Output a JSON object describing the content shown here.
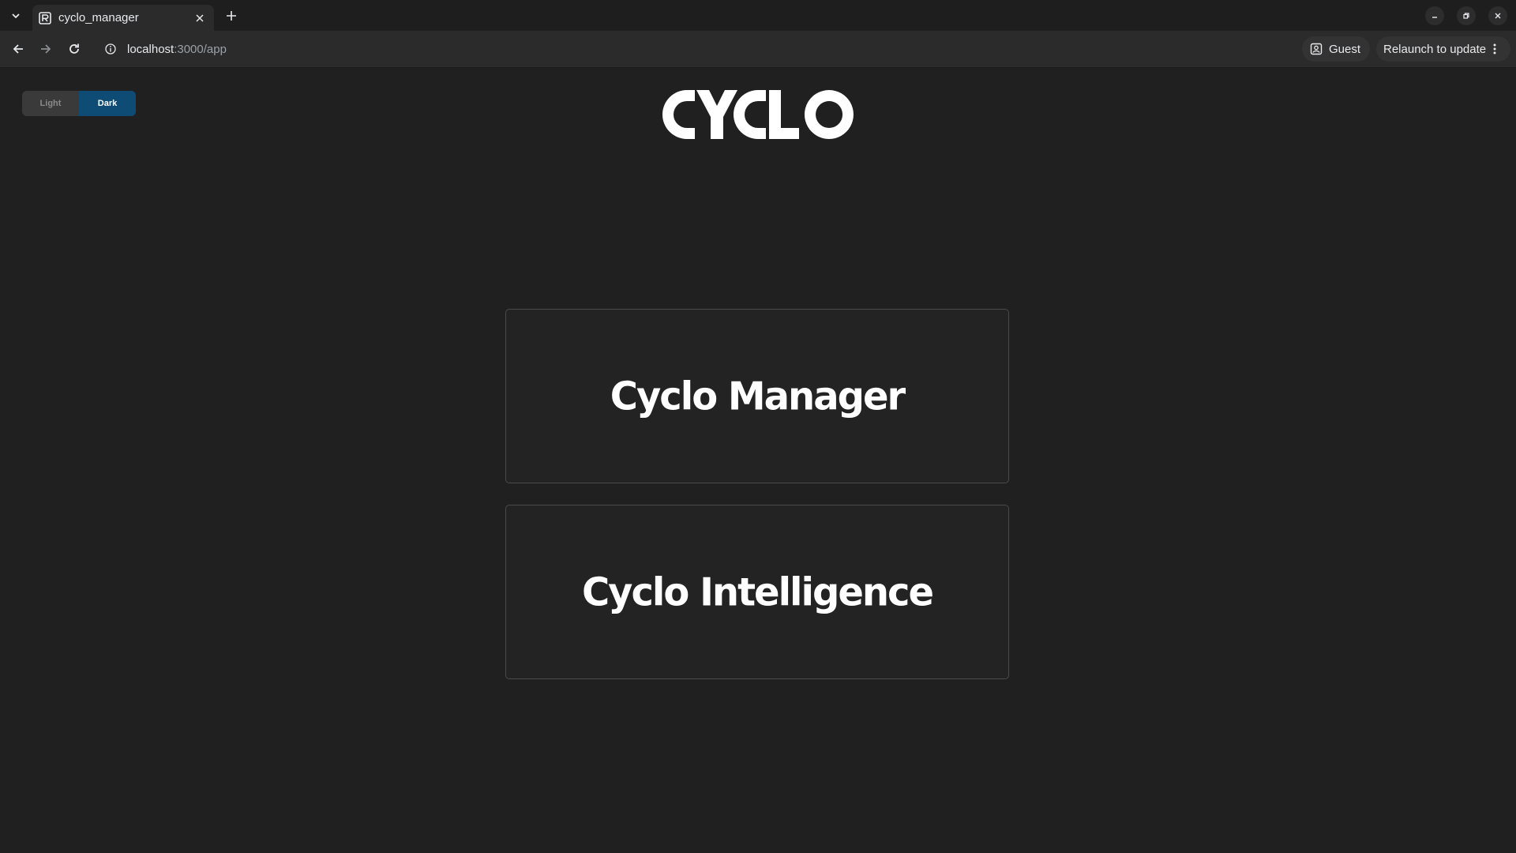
{
  "browser": {
    "tab_title": "cyclo_manager",
    "url_host": "localhost",
    "url_path": ":3000/app",
    "profile_label": "Guest",
    "relaunch_label": "Relaunch to update"
  },
  "theme_toggle": {
    "options": [
      "Light",
      "Dark"
    ],
    "selected": "Dark",
    "active_color": "#0f4c75"
  },
  "logo_text": "CYCLO",
  "cards": [
    {
      "title": "Cyclo Manager"
    },
    {
      "title": "Cyclo Intelligence"
    }
  ],
  "colors": {
    "background": "#202020",
    "card_background": "#232323",
    "card_border": "#4a4a4a",
    "text": "#ffffff"
  }
}
